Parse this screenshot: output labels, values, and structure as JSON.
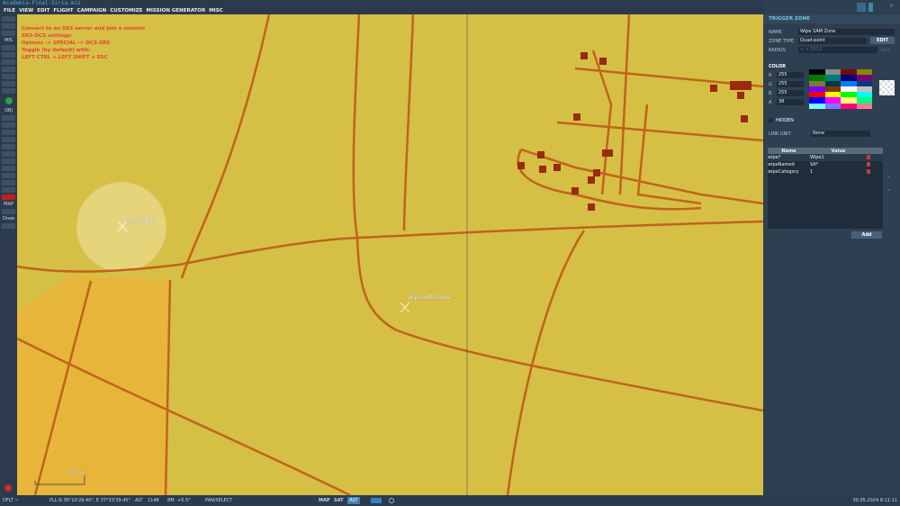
{
  "title": "Academia-Final-Siria.miz",
  "menu": [
    "FILE",
    "VIEW",
    "EDIT",
    "FLIGHT",
    "CAMPAIGN",
    "CUSTOMIZE",
    "MISSION GENERATOR",
    "MISC"
  ],
  "srs_notice": [
    "Connect to an SRS server and join a mission",
    "SRS-DCS settings:",
    "Options -> SPECIAL -> DCS-SRS",
    "Toggle (by default) with:",
    "LEFT CTRL + LEFT SHIFT + ESC"
  ],
  "toolbar": {
    "mis": "MIS",
    "obj": "OBJ",
    "map": "MAP",
    "draw": "Draw"
  },
  "map": {
    "labels": {
      "shot": "Shot1 SA11",
      "wipe": "Wipe SAM Zone"
    },
    "scale": "1000 m"
  },
  "panel": {
    "title": "TRIGGER ZONE",
    "name_label": "NAME",
    "name_value": "Wipe SAM Zone",
    "zone_type_label": "ZONE TYPE",
    "zone_type_value": "Quad-point",
    "edit": "EDIT",
    "radius_label": "RADIUS",
    "radius_value": "< > 3013",
    "radius_unit": "feet",
    "color_label": "COLOR",
    "rgba": [
      {
        "k": "R",
        "v": "255"
      },
      {
        "k": "G",
        "v": "255"
      },
      {
        "k": "B",
        "v": "255"
      },
      {
        "k": "A",
        "v": "38"
      }
    ],
    "palette": [
      "#000000",
      "#8a8a8a",
      "#7a0a0a",
      "#8a8a00",
      "#007a00",
      "#007a7a",
      "#00007a",
      "#7a007a",
      "#7a7a3a",
      "#003a3a",
      "#0a7aff",
      "#003a7a",
      "#7a00ff",
      "#7a3a00",
      "#ffffff",
      "#c0c0c0",
      "#ff0000",
      "#ffff00",
      "#00ff00",
      "#00ffff",
      "#0000ff",
      "#ff00ff",
      "#ffff7a",
      "#00ff7a",
      "#7affff",
      "#7a7aff",
      "#ff007a",
      "#ff7a9a"
    ],
    "hidden": "HIDDEN",
    "link_unit_label": "LINK UNIT",
    "link_unit_value": "None",
    "table": {
      "headers": [
        "Name",
        "Value"
      ],
      "rows": [
        {
          "name": "wipe?",
          "value": "Wipe1"
        },
        {
          "name": "wipeNamed",
          "value": "SA*"
        },
        {
          "name": "wipeCategory",
          "value": "1"
        }
      ]
    },
    "add": "Add"
  },
  "status": {
    "profile": "DFLT ~",
    "coords": "PLL  N 36°10'29.40\", E 37°33'39.45\"",
    "alt_label": "ALT",
    "alt": "1148",
    "bm_label": "BM",
    "bm": "+5.5°",
    "mode": "PAN/SELECT",
    "map": "MAP",
    "sat": "SAT",
    "alt_btn": "ALT",
    "datetime": "30.05.2024 8:11:11"
  }
}
